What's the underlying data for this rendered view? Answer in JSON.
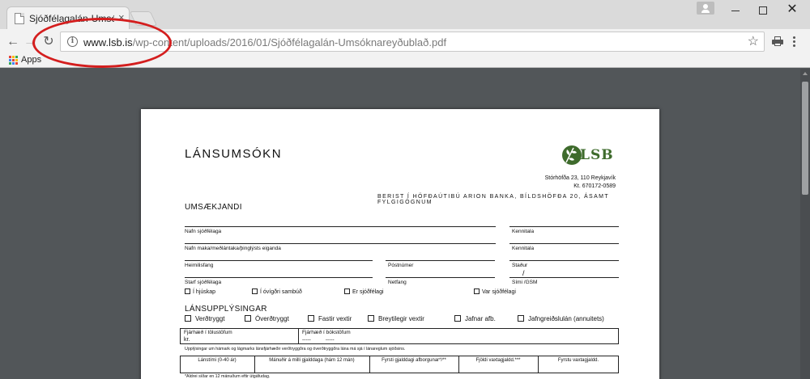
{
  "browser": {
    "tab_title": "Sjóðfélagalán-Umsóknar",
    "tab_close": "×",
    "url_host": "www.lsb.is",
    "url_path": "/wp-content/uploads/2016/01/Sjóðfélagalán-Umsóknareyðublað.pdf",
    "bookmark_apps": "Apps",
    "annotation_color": "#d41e1e"
  },
  "document": {
    "title": "LÁNSUMSÓKN",
    "logo_text": "LSB",
    "address_line1": "Stórhöfða 23, 110 Reykjavík",
    "address_line2": "Kt. 670172-0589",
    "submit_instruction": "BERIST Í HÖFÐAÚTIBÚ ARION BANKA, BÍLDSHÖFÐA 20, ÁSAMT FYLGIGÖGNUM",
    "applicant": {
      "heading": "UMSÆKJANDI",
      "name_label": "Nafn sjóðfélaga",
      "kennitala_label_1": "Kennitala",
      "spouse_label": "Nafn maka/meðlántaka/þinglýsts eiganda",
      "kennitala_label_2": "Kennitala",
      "address_label": "Heimilisfang",
      "postcode_label": "Póstnúmer",
      "place_label": "Staður",
      "slash": "/",
      "occupation_label": "Starf sjóðfélaga",
      "email_label": "Netfang",
      "phone_label": "Sími /GSM",
      "status_options": [
        "Í hjúskap",
        "Í óvígðri sambúð",
        "Er sjóðfélagi",
        "Var sjóðfélagi"
      ]
    },
    "loan": {
      "heading": "LÁNSUPPLÝSINGAR",
      "options": [
        "Verðtryggt",
        "Óverðtryggt",
        "Fastir vextir",
        "Breytilegir vextir",
        "Jafnar afb.",
        "Jafngreiðslulán (annuitets)"
      ],
      "amount_numbers_label": "Fjárhæð í tölustöfum",
      "amount_currency": "kr.",
      "amount_words_label": "Fjárhæð í bókstöfum",
      "amount_words_value": "-----          -----",
      "info_note": "Upplýsingar um hámark og lágmarks lánsfjárhæðir verðtryggðra og óverðtryggðra lána má sjá í lánareglum sjóðsins.",
      "table_headers": [
        "Lánstími (0-40 ár)",
        "Mánuðir á milli gjalddaga (hám 12 mán)",
        "Fyrsti gjalddagi afborgunar*/**",
        "Fjöldi vaxtagjaldd.***",
        "Fyrstu vaxtagjaldd."
      ],
      "footnote": "*Aldrei síðar en 12 mánuðum eftir útgáfudag."
    }
  }
}
